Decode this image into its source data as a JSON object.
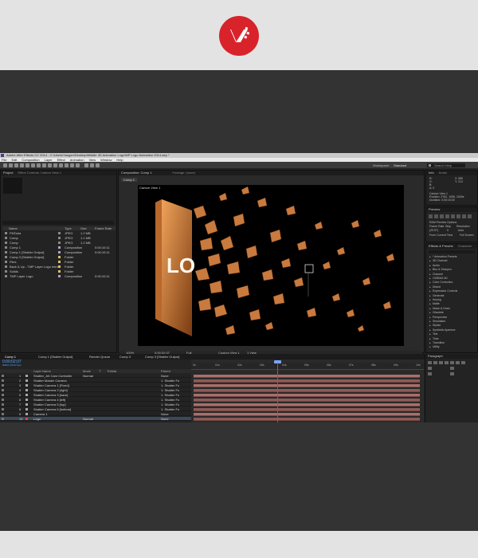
{
  "window": {
    "title": "Adobe After Effects CC 2014 - C:\\Users\\Yaugen\\Desktop\\Middle 3D Animation Logo\\MP Logo Animation 2014.aep *"
  },
  "menu": [
    "File",
    "Edit",
    "Composition",
    "Layer",
    "Effect",
    "Animation",
    "View",
    "Window",
    "Help"
  ],
  "toolbar": {
    "workspace_label": "Workspace:",
    "workspace_value": "Standard",
    "search_placeholder": "Search Help"
  },
  "project_panel": {
    "tabs": [
      "Project",
      "Effect Controls: Carbon View 1"
    ],
    "columns": [
      "Name",
      "Type",
      "Size",
      "Frame Rate"
    ],
    "items": [
      {
        "name": "PNTaria",
        "type": "JPEG",
        "size": "1.2 MB",
        "rate": "",
        "color": "#8a8a8a"
      },
      {
        "name": "Comp",
        "type": "JPEG",
        "size": "1.1 MB",
        "rate": "",
        "color": "#8a8a8a"
      },
      {
        "name": "Comp",
        "type": "JPEG",
        "size": "1.2 MB",
        "rate": "",
        "color": "#8a8a8a"
      },
      {
        "name": "Comp 1",
        "type": "Composition",
        "size": "",
        "rate": "0:00:10:11",
        "color": "#b4a0c8"
      },
      {
        "name": "Comp 1 [Shatter Output]",
        "type": "Composition",
        "size": "",
        "rate": "0:00:10:11",
        "color": "#b4a0c8"
      },
      {
        "name": "Comp 3 [Shatter Output]",
        "type": "Folder",
        "size": "",
        "rate": "",
        "color": "#d8c26b"
      },
      {
        "name": "Files",
        "type": "Folder",
        "size": "",
        "rate": "",
        "color": "#d8c26b"
      },
      {
        "name": "Back & Up - TMP Layer Logo Intros",
        "type": "Folder",
        "size": "",
        "rate": "",
        "color": "#d8c26b"
      },
      {
        "name": "Solids",
        "type": "Folder",
        "size": "",
        "rate": "",
        "color": "#d8c26b"
      },
      {
        "name": "TMP Layer Logo",
        "type": "Composition",
        "size": "",
        "rate": "0:00:10:11",
        "color": "#b4a0c8"
      }
    ]
  },
  "composition_panel": {
    "tab": "Composition: Comp 1",
    "footage_tab": "Footage: (none)",
    "sub_tab": "Comp 1",
    "active_camera": "Carbon View 1",
    "renderer": "Renderer:",
    "views_label": "Classic 3D",
    "logo_text": "LO",
    "zoom": "100%",
    "time": "0;00;02;07",
    "resolution": "Full",
    "camera_select": "Custom View 1",
    "view_count": "1 View"
  },
  "info_panel": {
    "tabs": [
      "Info",
      "Audio"
    ],
    "lines": [
      "R:",
      "G:",
      "B:",
      "A: 0",
      "X: 580",
      "Y: 212"
    ],
    "details": [
      "Carbon View 1",
      "Position: 2762, 1055, 1500e",
      "Duration: 0;00;10;00"
    ]
  },
  "preview_panel": {
    "title": "Preview",
    "ram_preview_label": "RAM Preview Options",
    "frame_rate_label": "Frame Rate",
    "skip_label": "Skip",
    "resolution_label": "Resolution",
    "frame_rate_value": "(29.97)",
    "skip_value": "0",
    "resolution_value": "Auto",
    "from_label": "From Current Time",
    "full_screen_label": "Full Screen"
  },
  "effects_panel": {
    "tabs": [
      "Effects & Presets",
      "Character"
    ],
    "items": [
      "* Animation Presets",
      "3D Channel",
      "Audio",
      "Blur & Sharpen",
      "Channel",
      "CINEMA 4D",
      "Color Correction",
      "Distort",
      "Expression Controls",
      "Generate",
      "Keying",
      "Matte",
      "Noise & Grain",
      "Obsolete",
      "Perspective",
      "Simulation",
      "Stylize",
      "Synthetic Aperture",
      "Text",
      "Time",
      "Transition",
      "Utility"
    ]
  },
  "timeline": {
    "tabs": [
      "Comp 1",
      "Comp 1 [Shatter Output]",
      "Render Queue",
      "Comp 3",
      "Comp 3 [Shatter Output]"
    ],
    "timecode": "0;00;02;07",
    "fps": "00067 (29.97 fps)",
    "columns": [
      "Layer Name",
      "Mode",
      "T",
      "TrkMat",
      "Parent"
    ],
    "layers": [
      {
        "num": "1",
        "name": "Shatter_Jet Cam Controller",
        "mode": "Normal",
        "parent": "None",
        "color": "#a8a8a8"
      },
      {
        "num": "2",
        "name": "Shatter Master Camera",
        "mode": "",
        "parent": "1. Shatter Fo",
        "color": "#a8a8a8"
      },
      {
        "num": "3",
        "name": "Shatter Camera 1 [Fixed]",
        "mode": "",
        "parent": "1. Shatter Fo",
        "color": "#a8a8a8"
      },
      {
        "num": "4",
        "name": "Shatter Camera 2 [right]",
        "mode": "",
        "parent": "1. Shatter Fo",
        "color": "#a8a8a8"
      },
      {
        "num": "5",
        "name": "Shatter Camera 3 [back]",
        "mode": "",
        "parent": "1. Shatter Fo",
        "color": "#a8a8a8"
      },
      {
        "num": "6",
        "name": "Shatter Camera 4 [left]",
        "mode": "",
        "parent": "1. Shatter Fo",
        "color": "#a8a8a8"
      },
      {
        "num": "7",
        "name": "Shatter Camera 5 [top]",
        "mode": "",
        "parent": "1. Shatter Fo",
        "color": "#a8a8a8"
      },
      {
        "num": "8",
        "name": "Shatter Camera 6 [bottom]",
        "mode": "",
        "parent": "1. Shatter Fo",
        "color": "#a8a8a8"
      },
      {
        "num": "9",
        "name": "Camera 1",
        "mode": "",
        "parent": "None",
        "color": "#a8a8a8"
      },
      {
        "num": "10",
        "name": "Logo",
        "mode": "Normal",
        "parent": "None",
        "color": "#d74a4a"
      }
    ],
    "ruler": [
      "0s",
      "01s",
      "02s",
      "03s",
      "04s",
      "05s",
      "06s",
      "07s",
      "08s",
      "09s",
      "10s"
    ]
  },
  "paragraph_panel": {
    "title": "Paragraph"
  }
}
